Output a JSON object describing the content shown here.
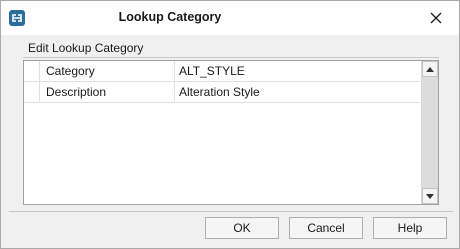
{
  "window": {
    "title": "Lookup Category",
    "app_icon": "app-logo-icon",
    "close_icon": "close-icon"
  },
  "group": {
    "label": "Edit Lookup Category"
  },
  "grid": {
    "rows": [
      {
        "key": "Category",
        "value": "ALT_STYLE"
      },
      {
        "key": "Description",
        "value": "Alteration Style"
      }
    ]
  },
  "buttons": {
    "ok": "OK",
    "cancel": "Cancel",
    "help": "Help"
  },
  "colors": {
    "app_icon_bg": "#2b6e9e",
    "dialog_bg": "#f0f0f0"
  }
}
